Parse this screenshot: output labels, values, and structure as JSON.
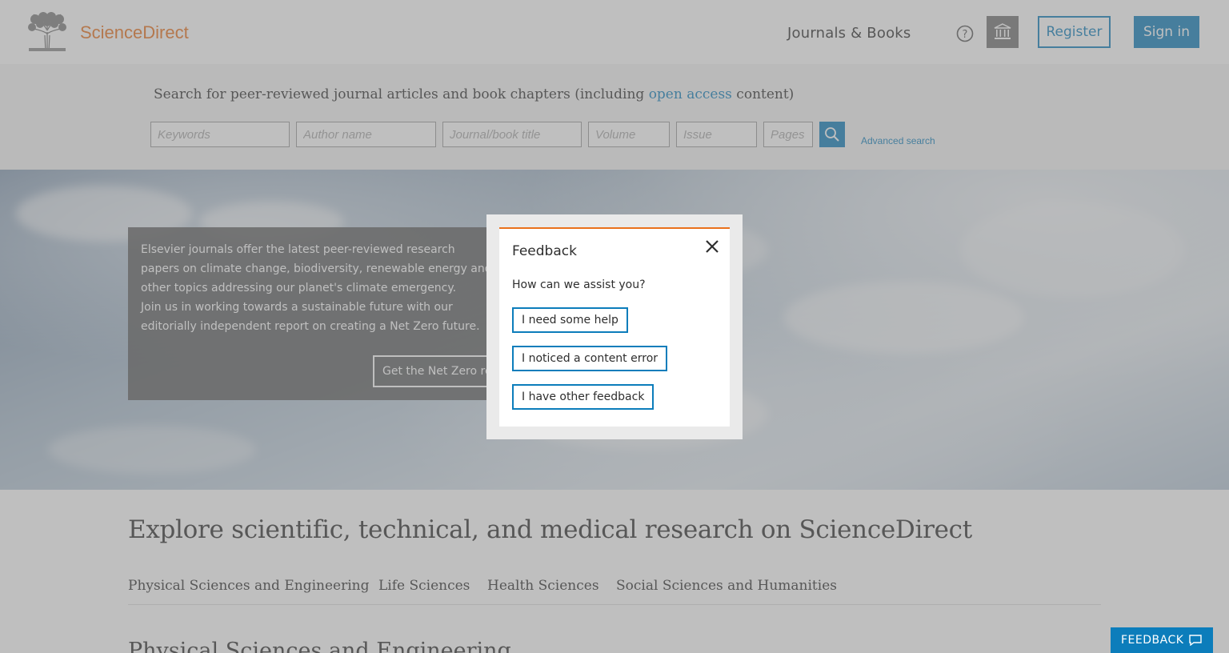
{
  "header": {
    "brand": "ScienceDirect",
    "journals_books": "Journals & Books",
    "register": "Register",
    "sign_in": "Sign in"
  },
  "search": {
    "title_before": "Search for peer-reviewed journal articles and book chapters (including ",
    "title_link": "open access",
    "title_after": " content)",
    "keywords_placeholder": "Keywords",
    "author_placeholder": "Author name",
    "journal_placeholder": "Journal/book title",
    "volume_placeholder": "Volume",
    "issue_placeholder": "Issue",
    "pages_placeholder": "Pages",
    "advanced": "Advanced search"
  },
  "hero": {
    "line1": "Elsevier journals offer the latest peer-reviewed research papers on climate change, biodiversity, renewable energy and other topics addressing our planet's climate emergency.",
    "line2": "Join us in working towards a sustainable future with our editorially independent report on creating a Net Zero future.",
    "cta": "Get the Net Zero report"
  },
  "explore": {
    "title": "Explore scientific, technical, and medical research on ScienceDirect",
    "tabs": [
      {
        "label": "Physical Sciences and Engineering"
      },
      {
        "label": "Life Sciences"
      },
      {
        "label": "Health Sciences"
      },
      {
        "label": "Social Sciences and Humanities"
      }
    ],
    "section_heading": "Physical Sciences and Engineering"
  },
  "modal": {
    "title": "Feedback",
    "question": "How can we assist you?",
    "options": [
      {
        "label": "I need some help"
      },
      {
        "label": "I noticed a content error"
      },
      {
        "label": "I have other feedback"
      }
    ]
  },
  "feedback_tab": {
    "label": "FEEDBACK"
  },
  "colors": {
    "brand": "#e9711c",
    "accent": "#0c7dbb"
  },
  "icons": [
    "elsevier-tree-logo",
    "help-icon",
    "institution-icon",
    "search-icon",
    "close-icon",
    "speech-bubble-icon"
  ]
}
